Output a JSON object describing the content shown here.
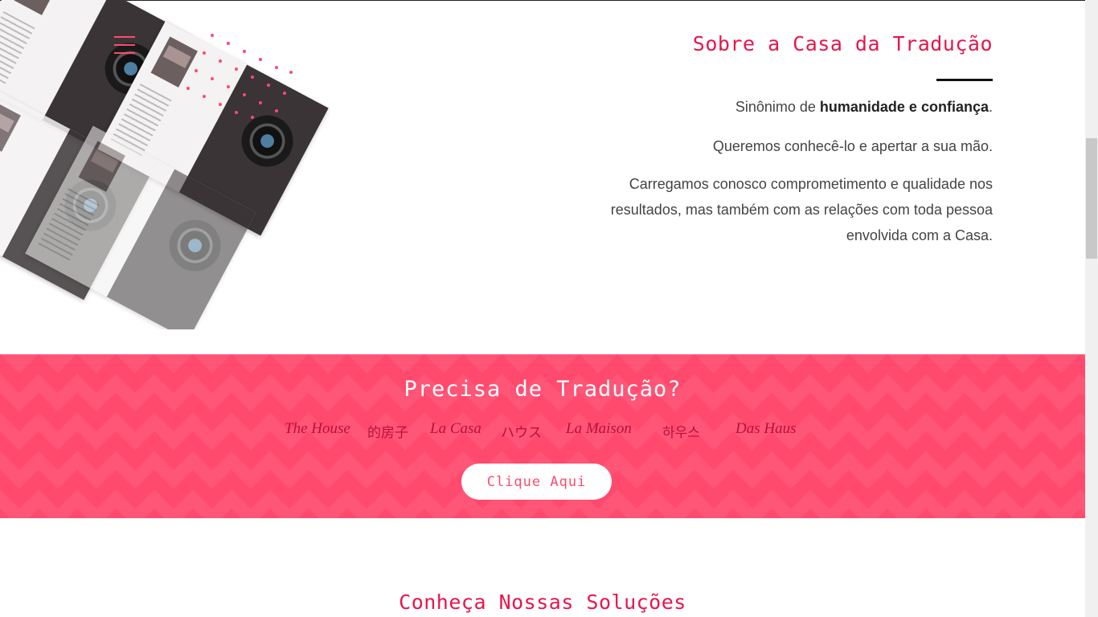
{
  "about": {
    "title": "Sobre a Casa da Tradução",
    "p1_prefix": "Sinônimo de ",
    "p1_bold": "humanidade e confiança",
    "p1_suffix": ".",
    "p2": "Queremos conhecê-lo e apertar a sua mão.",
    "p3": "Carregamos conosco comprometimento e qualidade nos resultados, mas também com as relações com toda pessoa envolvida com a Casa."
  },
  "banner": {
    "title": "Precisa de Tradução?",
    "words": [
      "The House",
      "的房子",
      "La Casa",
      "ハウス",
      "La Maison",
      "하우스",
      "Das Haus"
    ],
    "cta_label": "Clique Aqui"
  },
  "solutions": {
    "title": "Conheça Nossas Soluções"
  },
  "colors": {
    "accent": "#e8154d",
    "banner": "#ff4a6e",
    "text": "#444444"
  },
  "icons": {
    "menu": "hamburger-menu-icon"
  }
}
